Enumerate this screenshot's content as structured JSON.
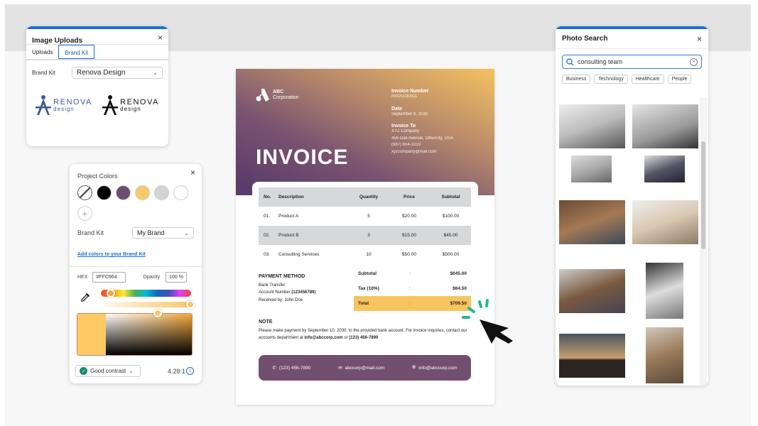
{
  "image_uploads": {
    "title": "Image Uploads",
    "close_icon": "×",
    "tabs": [
      {
        "label": "Uploads",
        "active": false
      },
      {
        "label": "Brand Kit",
        "active": true
      }
    ],
    "brand_kit_label": "Brand Kit",
    "brand_kit_value": "Renova Design",
    "logos": [
      {
        "name": "RENOVA",
        "sub": "design",
        "color": "#3b5998"
      },
      {
        "name": "RENOVA",
        "sub": "design",
        "color": "#111111"
      }
    ]
  },
  "project_colors": {
    "title": "Project Colors",
    "close_icon": "×",
    "swatches": [
      "none",
      "#000000",
      "#6b4f6e",
      "#f6c96b",
      "#d4d4d4",
      "#ffffff"
    ],
    "add_icon": "+",
    "brand_kit_label": "Brand Kit",
    "brand_kit_value": "My Brand",
    "add_colors_link": "Add colors to your Brand Kit",
    "hex_label": "HEX",
    "hex_value": "#FFC964",
    "opacity_label": "Opacity",
    "opacity_value": "100 %",
    "contrast_label": "Good contrast",
    "contrast_ratio": "4.28:1",
    "info_icon": "i"
  },
  "invoice": {
    "company_line1": "ABC",
    "company_line2": "Corporation",
    "title": "INVOICE",
    "invoice_number_label": "Invoice Number",
    "invoice_number": "INV20230911",
    "date_label": "Date",
    "date": "September 8, 2030",
    "invoice_to_label": "Invoice To",
    "invoice_to": [
      "XYZ Company",
      "456 Oak Avenue, Othercity, USA",
      "(987) 654-3210",
      "xyzcompany@mail.com"
    ],
    "columns": [
      "No.",
      "Description",
      "Quantity",
      "Price",
      "Subtotal"
    ],
    "rows": [
      [
        "01.",
        "Product A",
        "5",
        "$20.00",
        "$100.00"
      ],
      [
        "02.",
        "Product B",
        "3",
        "$15.00",
        "$45.00"
      ],
      [
        "03.",
        "Consulting Services",
        "10",
        "$50.00",
        "$500.00"
      ]
    ],
    "payment_method_label": "PAYMENT METHOD",
    "payment_lines": [
      "Bank Transfer",
      "Account Number",
      "(123456789)",
      "Received by: John Doe"
    ],
    "totals": [
      {
        "label": "Subtotal",
        "sep": ":",
        "value": "$645.00"
      },
      {
        "label": "Tax (10%)",
        "sep": ":",
        "value": "$64.50"
      },
      {
        "label": "Total",
        "sep": ":",
        "value": "$709.50"
      }
    ],
    "note_label": "NOTE",
    "note_text_1": "Please make payment by September 10, 2030, to the provided bank account. For invoice inquiries, contact our accounts department at",
    "note_email": "info@abccorp.com",
    "note_or": "or",
    "note_phone": "(123) 456-7890",
    "footer": {
      "phone": "(123) 456-7890",
      "email": "abccorp@mail.com",
      "web": "info@abccorp.com"
    }
  },
  "photo_search": {
    "title": "Photo Search",
    "close_icon": "×",
    "query": "consulting team",
    "chips": [
      "Business",
      "Technology",
      "Healthcare",
      "People"
    ],
    "photos": [
      "team-meeting-window",
      "consultants-laptop",
      "person-window-office",
      "business-handshake-desk",
      "hands-stacked-table",
      "handshake-office",
      "overhead-team-table",
      "overhead-laptops",
      "sunset-silhouettes-jumping",
      "hands-over-desk"
    ]
  },
  "colors": {
    "accent": "#1a6fd8",
    "invoice_purple": "#724f6e",
    "invoice_gold": "#f8c45f",
    "cursor_accent": "#1fba8f"
  }
}
